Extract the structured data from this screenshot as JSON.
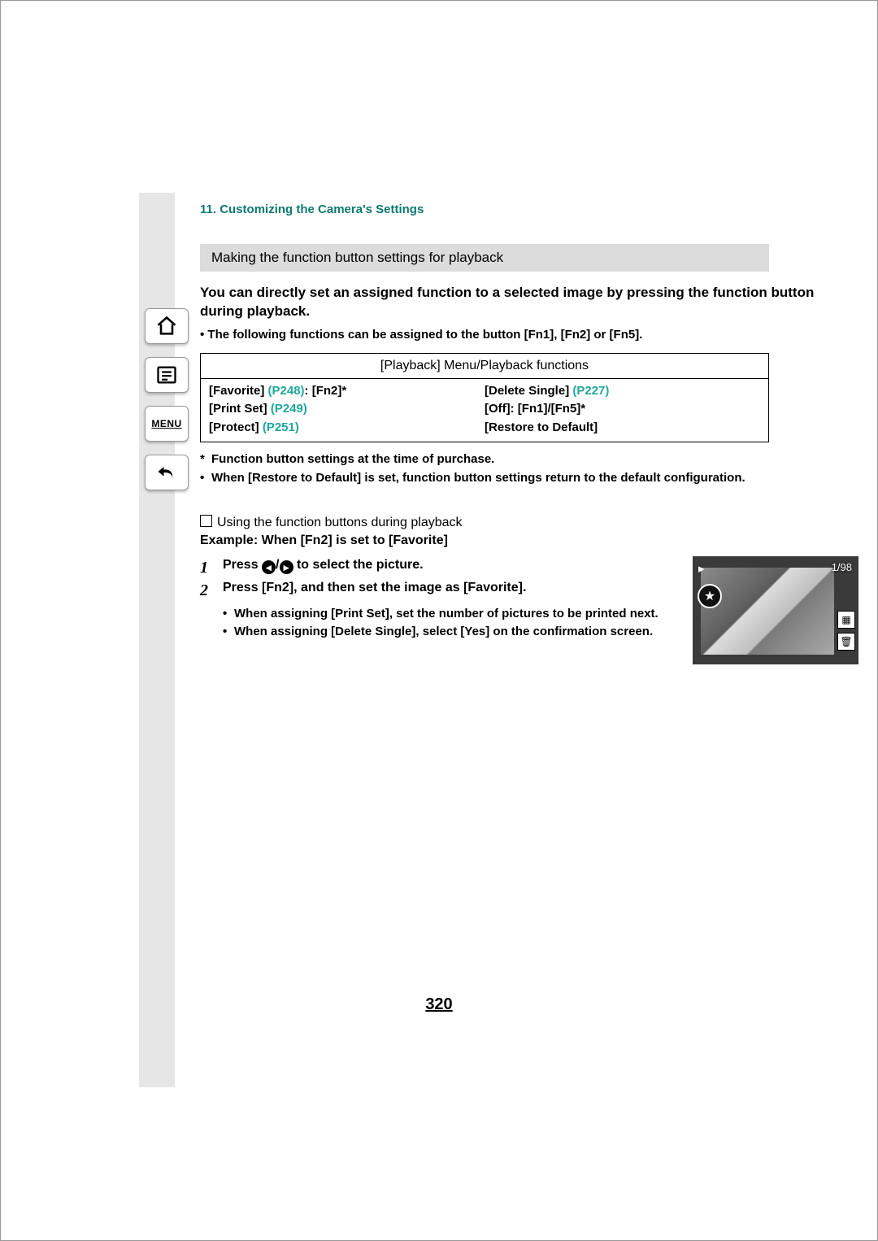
{
  "breadcrumb": {
    "number": "11.",
    "title": "Customizing the Camera's Settings"
  },
  "sidebar": {
    "menu_label": "MENU"
  },
  "heading": "Making the function button settings for playback",
  "intro": "You can directly set an assigned function to a selected image by pressing the function button during playback.",
  "sub_intro": "• The following functions can be assigned to the button [Fn1], [Fn2] or [Fn5].",
  "table": {
    "header": "[Playback] Menu/Playback functions",
    "left": {
      "r1_label": "[Favorite] ",
      "r1_link": "(P248)",
      "r1_after": ": [Fn2]",
      "r2_label": "[Print Set] ",
      "r2_link": "(P249)",
      "r3_label": "[Protect] ",
      "r3_link": "(P251)"
    },
    "right": {
      "r1_label": "[Delete Single] ",
      "r1_link": "(P227)",
      "r2": "[Off]: [Fn1]/[Fn5]",
      "r3": "[Restore to Default]"
    }
  },
  "notes": {
    "n1_mark": "*",
    "n1_text": "Function button settings at the time of purchase.",
    "n2_bullet": "•",
    "n2_text": "When [Restore to Default] is set, function button settings return to the default configuration."
  },
  "usage": {
    "title": "Using the function buttons during playback",
    "example": "Example: When [Fn2] is set to [Favorite]",
    "step1_num": "1",
    "step1_text_a": "Press ",
    "step1_text_b": " to select the picture.",
    "step2_num": "2",
    "step2_text": "Press [Fn2], and then set the image as [Favorite].",
    "bullet1": "When assigning [Print Set], set the number of pictures to be printed next.",
    "bullet2": "When assigning [Delete Single], select [Yes] on the confirmation screen."
  },
  "preview": {
    "counter": "1/98",
    "star": "★"
  },
  "page_number": "320"
}
